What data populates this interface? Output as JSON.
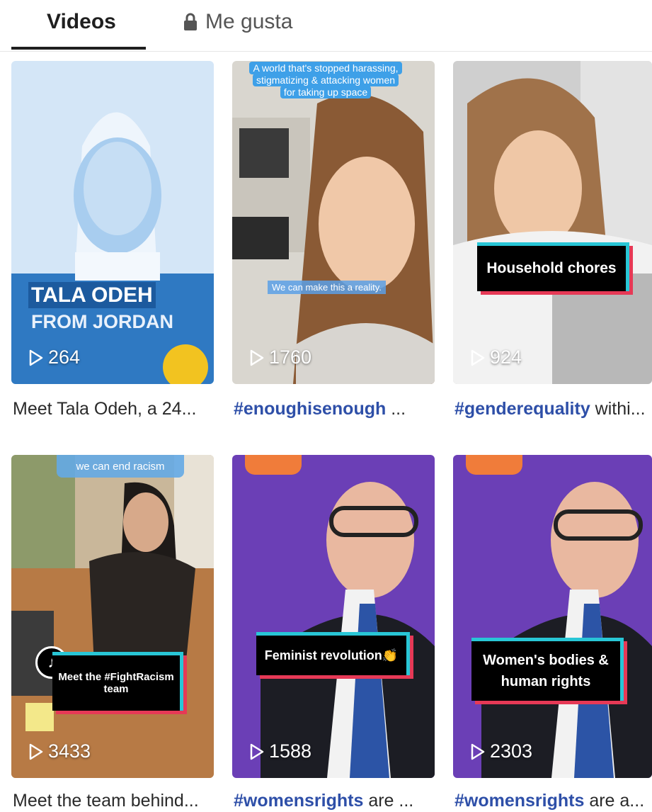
{
  "tabs": {
    "videos_label": "Videos",
    "likes_label": "Me gusta"
  },
  "videos": [
    {
      "plays": "264",
      "caption_tag": "",
      "caption_text": "Meet Tala Odeh, a 24...",
      "overlay_line1": "TALA ODEH",
      "overlay_line2": "FROM JORDAN"
    },
    {
      "plays": "1760",
      "caption_tag": "#enoughisenough",
      "caption_text": " ...",
      "overlay_top": "A world that's stopped harassing, stigmatizing & attacking women for taking up space",
      "overlay_sub": "We can make this a reality."
    },
    {
      "plays": "924",
      "caption_tag": "#genderequality",
      "caption_text": " withi...",
      "overlay_box": "Household chores"
    },
    {
      "plays": "3433",
      "caption_tag": "",
      "caption_text": "Meet the team behind...",
      "overlay_top": "we can end racism",
      "overlay_box": "Meet the #FightRacism team"
    },
    {
      "plays": "1588",
      "caption_tag": "#womensrights",
      "caption_text": " are ...",
      "overlay_box": "Feminist revolution👏"
    },
    {
      "plays": "2303",
      "caption_tag": "#womensrights",
      "caption_text": " are a...",
      "overlay_box": "Women's bodies & human rights"
    }
  ],
  "colors": {
    "hashtag": "#2e4fa8",
    "tab_underline": "#1f1f1f",
    "tiktok_cyan": "#28c6d6",
    "tiktok_red": "#e63956"
  },
  "icons": [
    "lock-icon",
    "play-icon",
    "tiktok-logo-icon"
  ]
}
